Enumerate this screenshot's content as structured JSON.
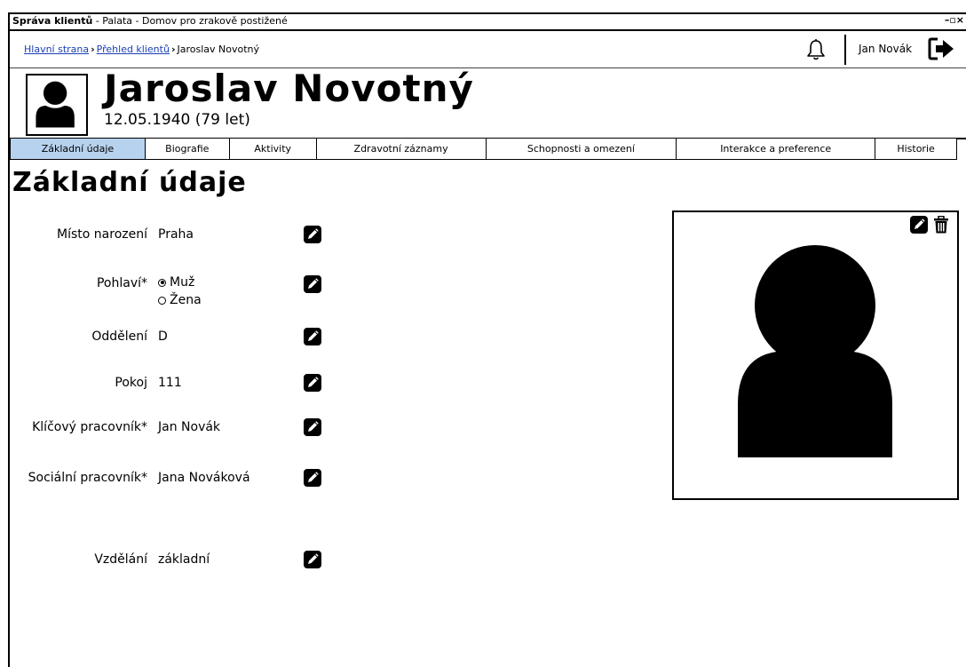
{
  "window": {
    "title_app": "Správa klientů",
    "title_rest": " - Palata - Domov pro zrakově postižené",
    "controls": "–▫×"
  },
  "breadcrumb": {
    "home": "Hlavní strana",
    "overview": "Přehled klientů",
    "current": "Jaroslav Novotný",
    "separator": "›"
  },
  "user": {
    "name": "Jan Novák"
  },
  "client": {
    "name": "Jaroslav Novotný",
    "dob": "12.05.1940 (79 let)"
  },
  "tabs": [
    {
      "label": "Základní údaje",
      "active": true
    },
    {
      "label": "Biografie"
    },
    {
      "label": "Aktivity"
    },
    {
      "label": "Zdravotní záznamy"
    },
    {
      "label": "Schopnosti a omezení"
    },
    {
      "label": "Interakce a preference"
    },
    {
      "label": "Historie"
    }
  ],
  "section": {
    "title": "Základní údaje"
  },
  "fields": {
    "birthplace": {
      "label": "Místo narození",
      "value": "Praha"
    },
    "gender": {
      "label": "Pohlaví*",
      "options": [
        "Muž",
        "Žena"
      ],
      "selected": "Muž"
    },
    "department": {
      "label": "Oddělení",
      "value": "D"
    },
    "room": {
      "label": "Pokoj",
      "value": "111"
    },
    "key_worker": {
      "label": "Klíčový pracovník*",
      "value": "Jan Novák"
    },
    "social_worker": {
      "label": "Sociální pracovník*",
      "value": "Jana Nováková"
    },
    "education": {
      "label": "Vzdělání",
      "value": "základní"
    }
  },
  "icons": {
    "bell": "bell-icon",
    "logout": "logout-icon",
    "edit": "pencil-icon",
    "delete": "trash-icon",
    "avatar": "person-icon"
  },
  "colors": {
    "active_tab": "#b7d2ee",
    "link": "#1a3fb5"
  }
}
